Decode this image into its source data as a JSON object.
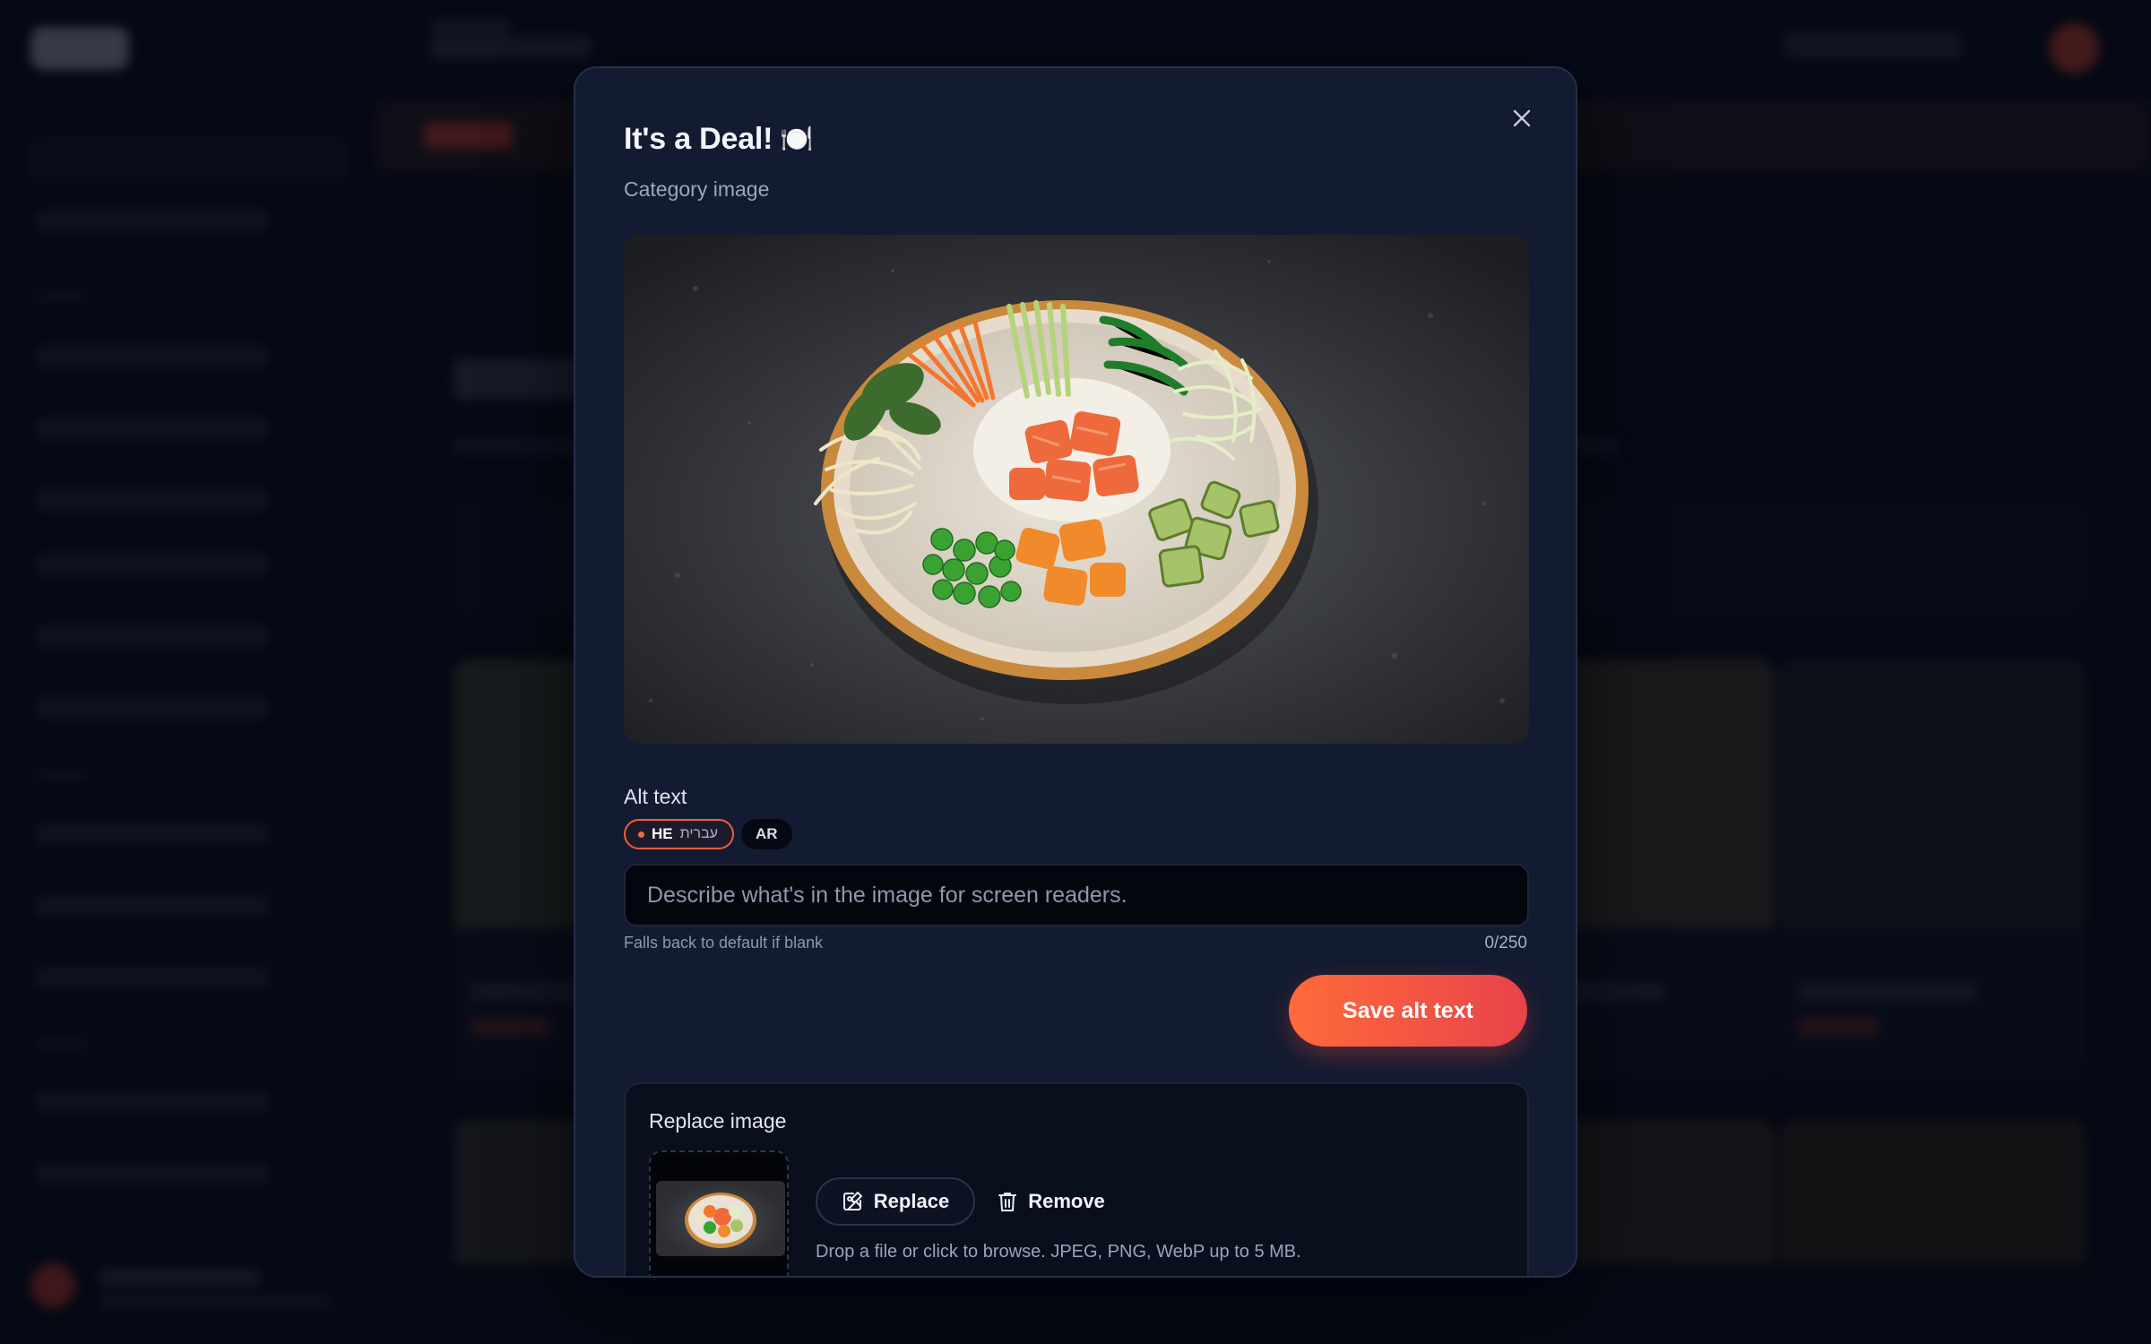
{
  "modal": {
    "title": "It's a Deal!",
    "title_emoji": "🍽️",
    "subtitle": "Category image",
    "image_description": "Poke bowl with salmon, vegetables and sprouts on dark stone",
    "alt_text": {
      "label": "Alt text",
      "languages": [
        {
          "code": "HE",
          "native": "עברית",
          "active": true
        },
        {
          "code": "AR",
          "native": "",
          "active": false
        }
      ],
      "placeholder": "Describe what's in the image for screen readers.",
      "value": "",
      "hint": "Falls back to default if blank",
      "counter": "0/250",
      "save_label": "Save alt text"
    },
    "replace": {
      "title": "Replace image",
      "replace_label": "Replace",
      "remove_label": "Remove",
      "drop_hint": "Drop a file or click to browse. JPEG, PNG, WebP up to 5 MB."
    }
  },
  "icons": {
    "close": "close-icon",
    "replace": "image-edit-icon",
    "remove": "trash-icon",
    "language_active": "dot-icon"
  },
  "colors": {
    "accent_start": "#ff6a3a",
    "accent_end": "#e8434b",
    "modal_bg": "#121b31",
    "page_bg": "#070b18"
  }
}
